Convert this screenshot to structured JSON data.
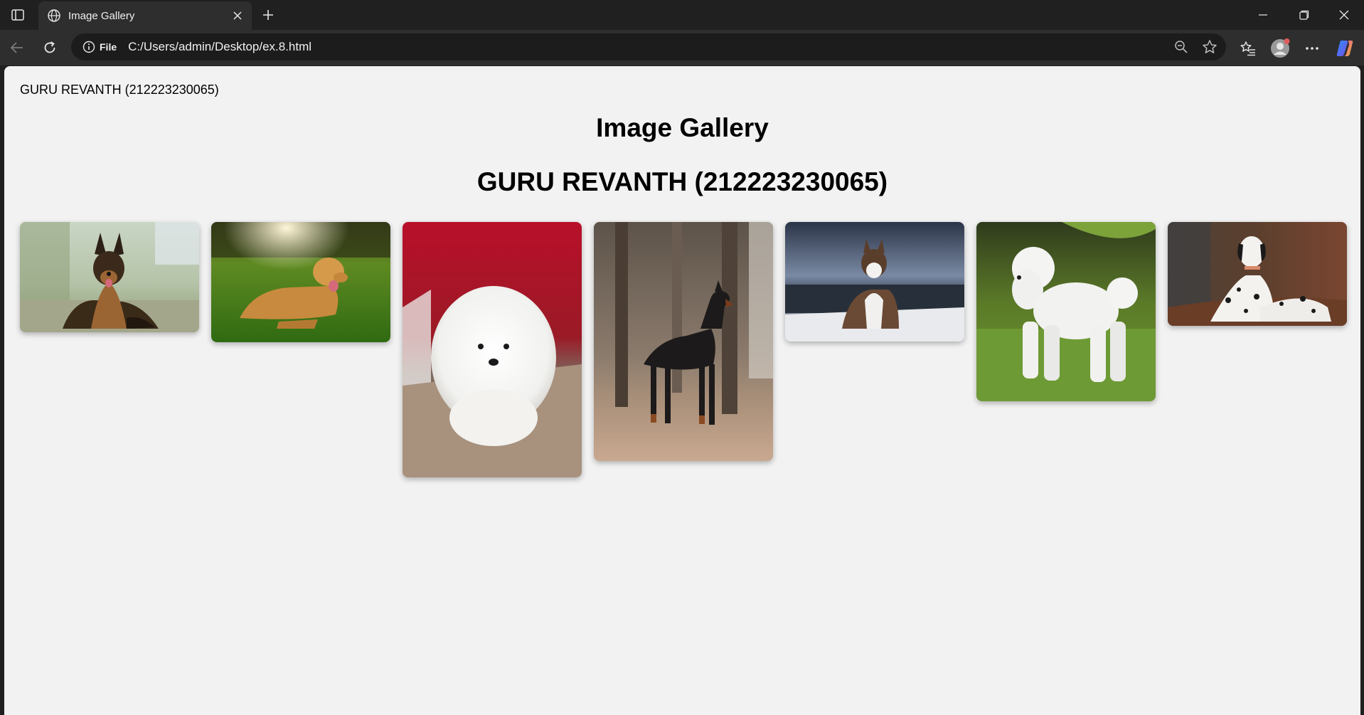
{
  "browser": {
    "tab_title": "Image Gallery",
    "info_chip_label": "File",
    "url": "C:/Users/admin/Desktop/ex.8.html"
  },
  "page": {
    "top_text": "GURU REVANTH (212223230065)",
    "heading": "Image Gallery",
    "subheading": "GURU REVANTH (212223230065)"
  },
  "gallery": {
    "images": [
      {
        "subject": "German Shepherd lying on grass"
      },
      {
        "subject": "Golden Retriever lying on grass"
      },
      {
        "subject": "White Pomeranian puppy"
      },
      {
        "subject": "Doberman standing in forest"
      },
      {
        "subject": "Siberian Husky sitting by the sea"
      },
      {
        "subject": "White Poodle standing on lawn"
      },
      {
        "subject": "Dalmatian lying on leaves"
      }
    ]
  },
  "colors": {
    "browser_frame": "#202020",
    "toolbar": "#2e2e2e",
    "omnibox": "#1c1c1c",
    "page_background": "#f2f2f2",
    "text": "#000000"
  },
  "icons": [
    "sidebar-toggle-icon",
    "globe-icon",
    "close-icon",
    "plus-icon",
    "minimize-icon",
    "restore-icon",
    "back-arrow-icon",
    "refresh-icon",
    "info-icon",
    "zoom-out-icon",
    "star-icon",
    "favorites-icon",
    "profile-icon",
    "more-icon",
    "copilot-icon"
  ]
}
